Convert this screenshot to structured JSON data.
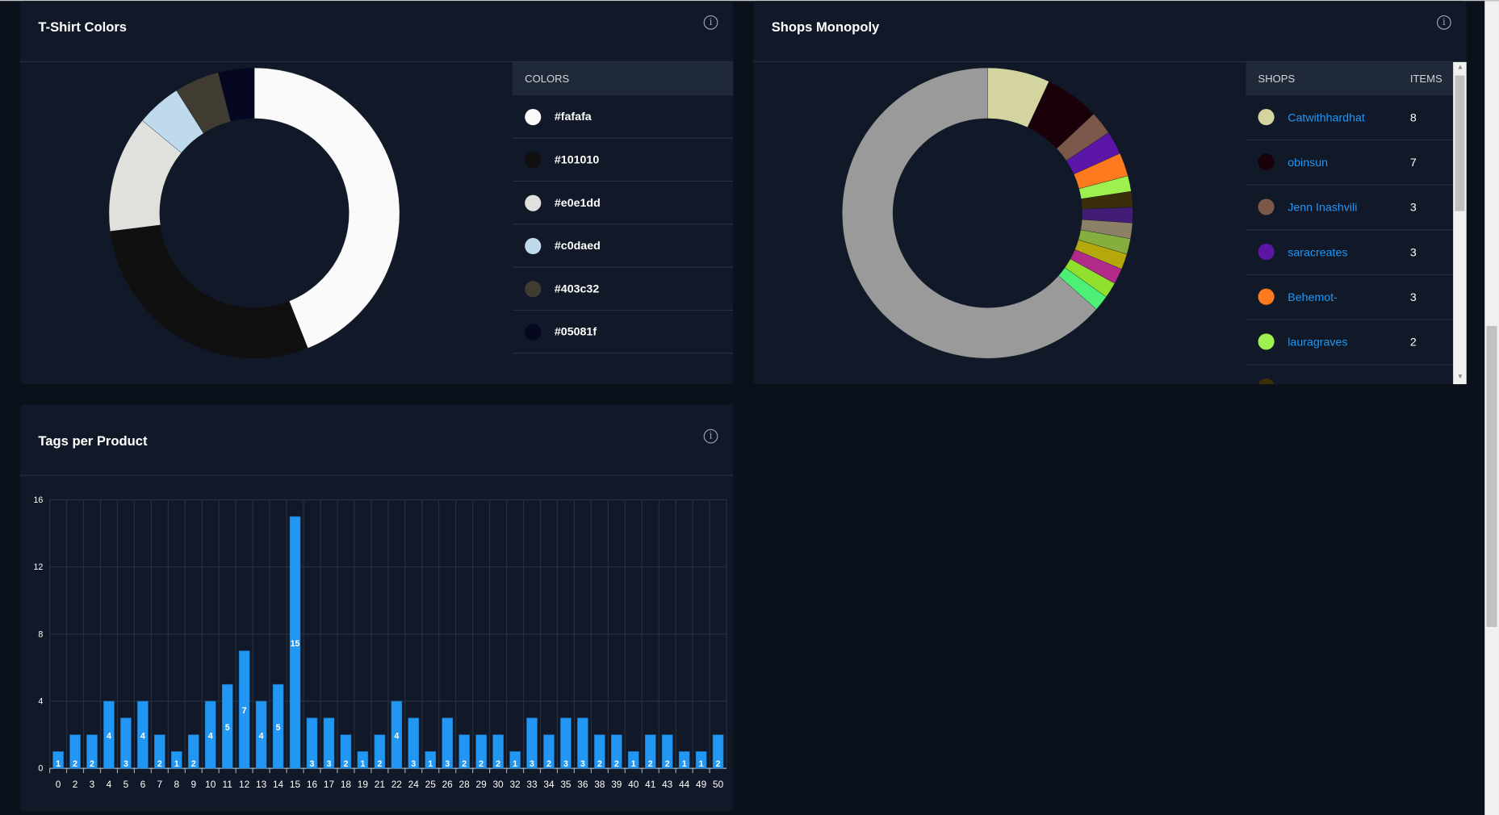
{
  "tshirt": {
    "title": "T-Shirt Colors",
    "legend_header": "COLORS",
    "chart_data": {
      "type": "pie",
      "donut": true,
      "categories": [
        "#fafafa",
        "#101010",
        "#e0e1dd",
        "#c0daed",
        "#403c32",
        "#05081f"
      ],
      "values": [
        44,
        29,
        13,
        5,
        5,
        4
      ],
      "colors": [
        "#fafafa",
        "#101010",
        "#e0e1dd",
        "#c0daed",
        "#403c32",
        "#05081f"
      ]
    }
  },
  "shops": {
    "title": "Shops Monopoly",
    "header_shops": "SHOPS",
    "header_items": "ITEMS",
    "rows": [
      {
        "name": "Catwithhardhat",
        "items": "8",
        "color": "#d4d4a0"
      },
      {
        "name": "obinsun",
        "items": "7",
        "color": "#1a0008"
      },
      {
        "name": "Jenn Inashvili",
        "items": "3",
        "color": "#7b5849"
      },
      {
        "name": "saracreates",
        "items": "3",
        "color": "#5b16a8"
      },
      {
        "name": "Behemot-",
        "items": "3",
        "color": "#fd7a1e"
      },
      {
        "name": "lauragraves",
        "items": "2",
        "color": "#9ef04e"
      }
    ],
    "chart_data": {
      "type": "pie",
      "donut": true,
      "values": [
        8,
        7,
        3,
        3,
        3,
        2,
        2,
        2,
        2,
        2,
        2,
        2,
        2,
        2,
        73
      ],
      "colors": [
        "#d4d4a0",
        "#1a0008",
        "#7b5849",
        "#5b16a8",
        "#fd7a1e",
        "#9ef04e",
        "#3a2e0b",
        "#421c75",
        "#8c8066",
        "#86ae3e",
        "#b5a80d",
        "#b22b8a",
        "#90e02d",
        "#4def77",
        "#9a9a9a"
      ]
    }
  },
  "tags": {
    "title": "Tags per Product",
    "chart_data": {
      "type": "bar",
      "categories": [
        "0",
        "2",
        "3",
        "4",
        "5",
        "6",
        "7",
        "8",
        "9",
        "10",
        "11",
        "12",
        "13",
        "14",
        "15",
        "16",
        "17",
        "18",
        "19",
        "21",
        "22",
        "24",
        "25",
        "26",
        "28",
        "29",
        "30",
        "32",
        "33",
        "34",
        "35",
        "36",
        "38",
        "39",
        "40",
        "41",
        "43",
        "44",
        "49",
        "50"
      ],
      "values": [
        1,
        2,
        2,
        4,
        3,
        4,
        2,
        1,
        2,
        4,
        5,
        7,
        4,
        5,
        15,
        3,
        3,
        2,
        1,
        2,
        4,
        3,
        1,
        3,
        2,
        2,
        2,
        1,
        3,
        2,
        3,
        3,
        2,
        2,
        1,
        2,
        2,
        1,
        1,
        2
      ],
      "ylim": [
        0,
        16
      ],
      "yticks": [
        0,
        4,
        8,
        12,
        16
      ],
      "grid": true,
      "bar_color": "#2196f3"
    }
  },
  "icons": {
    "info": "info-circle-icon"
  }
}
